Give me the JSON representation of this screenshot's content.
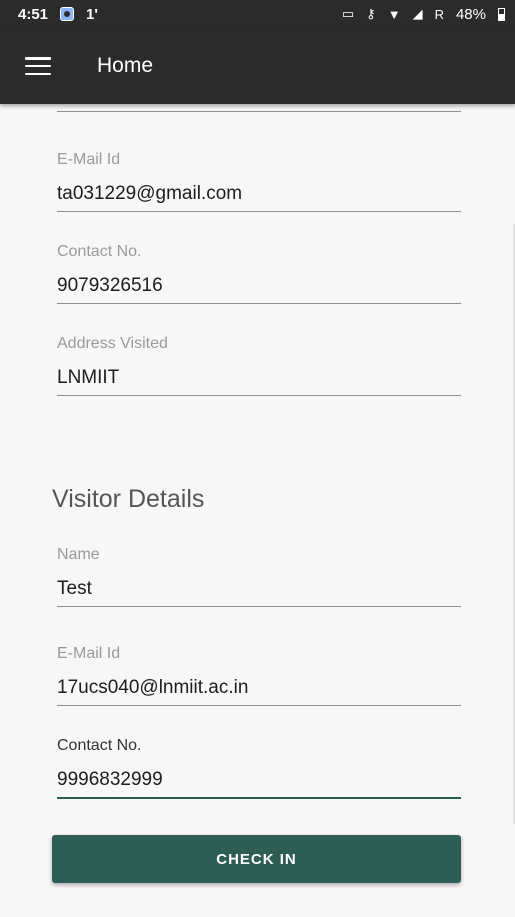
{
  "status_bar": {
    "time": "4:51",
    "notification": "1'",
    "network": "R",
    "battery": "48%"
  },
  "app_bar": {
    "title": "Home"
  },
  "host": {
    "cut_value": "",
    "email_label": "E-Mail Id",
    "email_value": "ta031229@gmail.com",
    "contact_label": "Contact No.",
    "contact_value": "9079326516",
    "address_label": "Address Visited",
    "address_value": "LNMIIT"
  },
  "visitor": {
    "section_title": "Visitor Details",
    "name_label": "Name",
    "name_value": "Test",
    "email_label": "E-Mail Id",
    "email_value": "17ucs040@lnmiit.ac.in",
    "contact_label": "Contact No.",
    "contact_value": "9996832999"
  },
  "actions": {
    "check_in_label": "CHECK IN"
  },
  "colors": {
    "app_bar": "#2b2b2b",
    "accent": "#2e5e53",
    "background": "#f7f7f7"
  }
}
